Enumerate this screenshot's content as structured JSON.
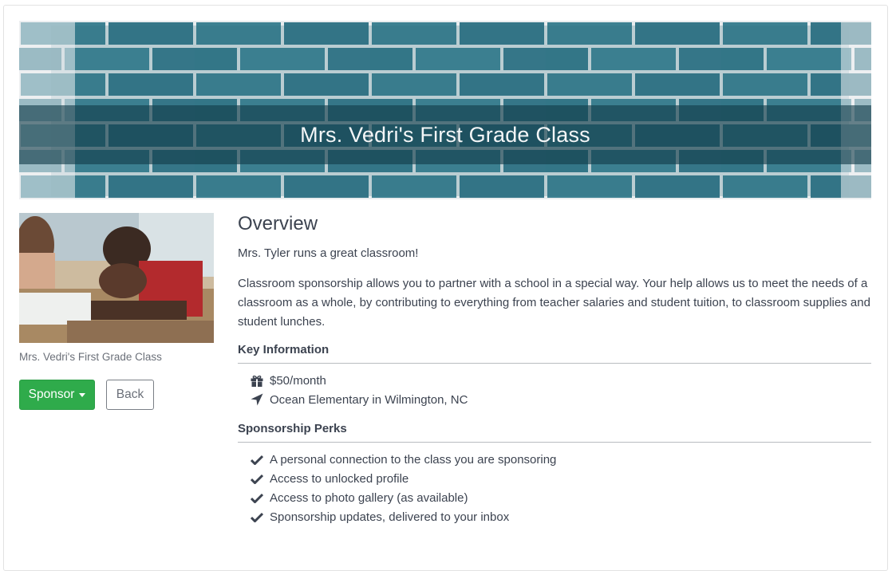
{
  "banner": {
    "title": "Mrs. Vedri's First Grade Class"
  },
  "sidebar": {
    "photo_caption": "Mrs. Vedri's First Grade Class",
    "sponsor_label": "Sponsor",
    "back_label": "Back"
  },
  "overview": {
    "title": "Overview",
    "intro": "Mrs. Tyler runs a great classroom!",
    "description": "Classroom sponsorship allows you to partner with a school in a special way. Your help allows us to meet the needs of a classroom as a whole, by contributing to everything from teacher salaries and student tuition, to classroom supplies and student lunches."
  },
  "key_information": {
    "title": "Key Information",
    "items": [
      {
        "icon": "gift-icon",
        "text": "$50/month"
      },
      {
        "icon": "location-arrow-icon",
        "text": "Ocean Elementary in Wilmington, NC"
      }
    ]
  },
  "perks": {
    "title": "Sponsorship Perks",
    "items": [
      {
        "icon": "check-icon",
        "text": "A personal connection to the class you are sponsoring"
      },
      {
        "icon": "check-icon",
        "text": "Access to unlocked profile"
      },
      {
        "icon": "check-icon",
        "text": "Access to photo gallery (as available)"
      },
      {
        "icon": "check-icon",
        "text": "Sponsorship updates, delivered to your inbox"
      }
    ]
  },
  "colors": {
    "sponsor_button": "#2fab4b",
    "banner_brick": "#2e6f7d",
    "text": "#3c4350"
  }
}
